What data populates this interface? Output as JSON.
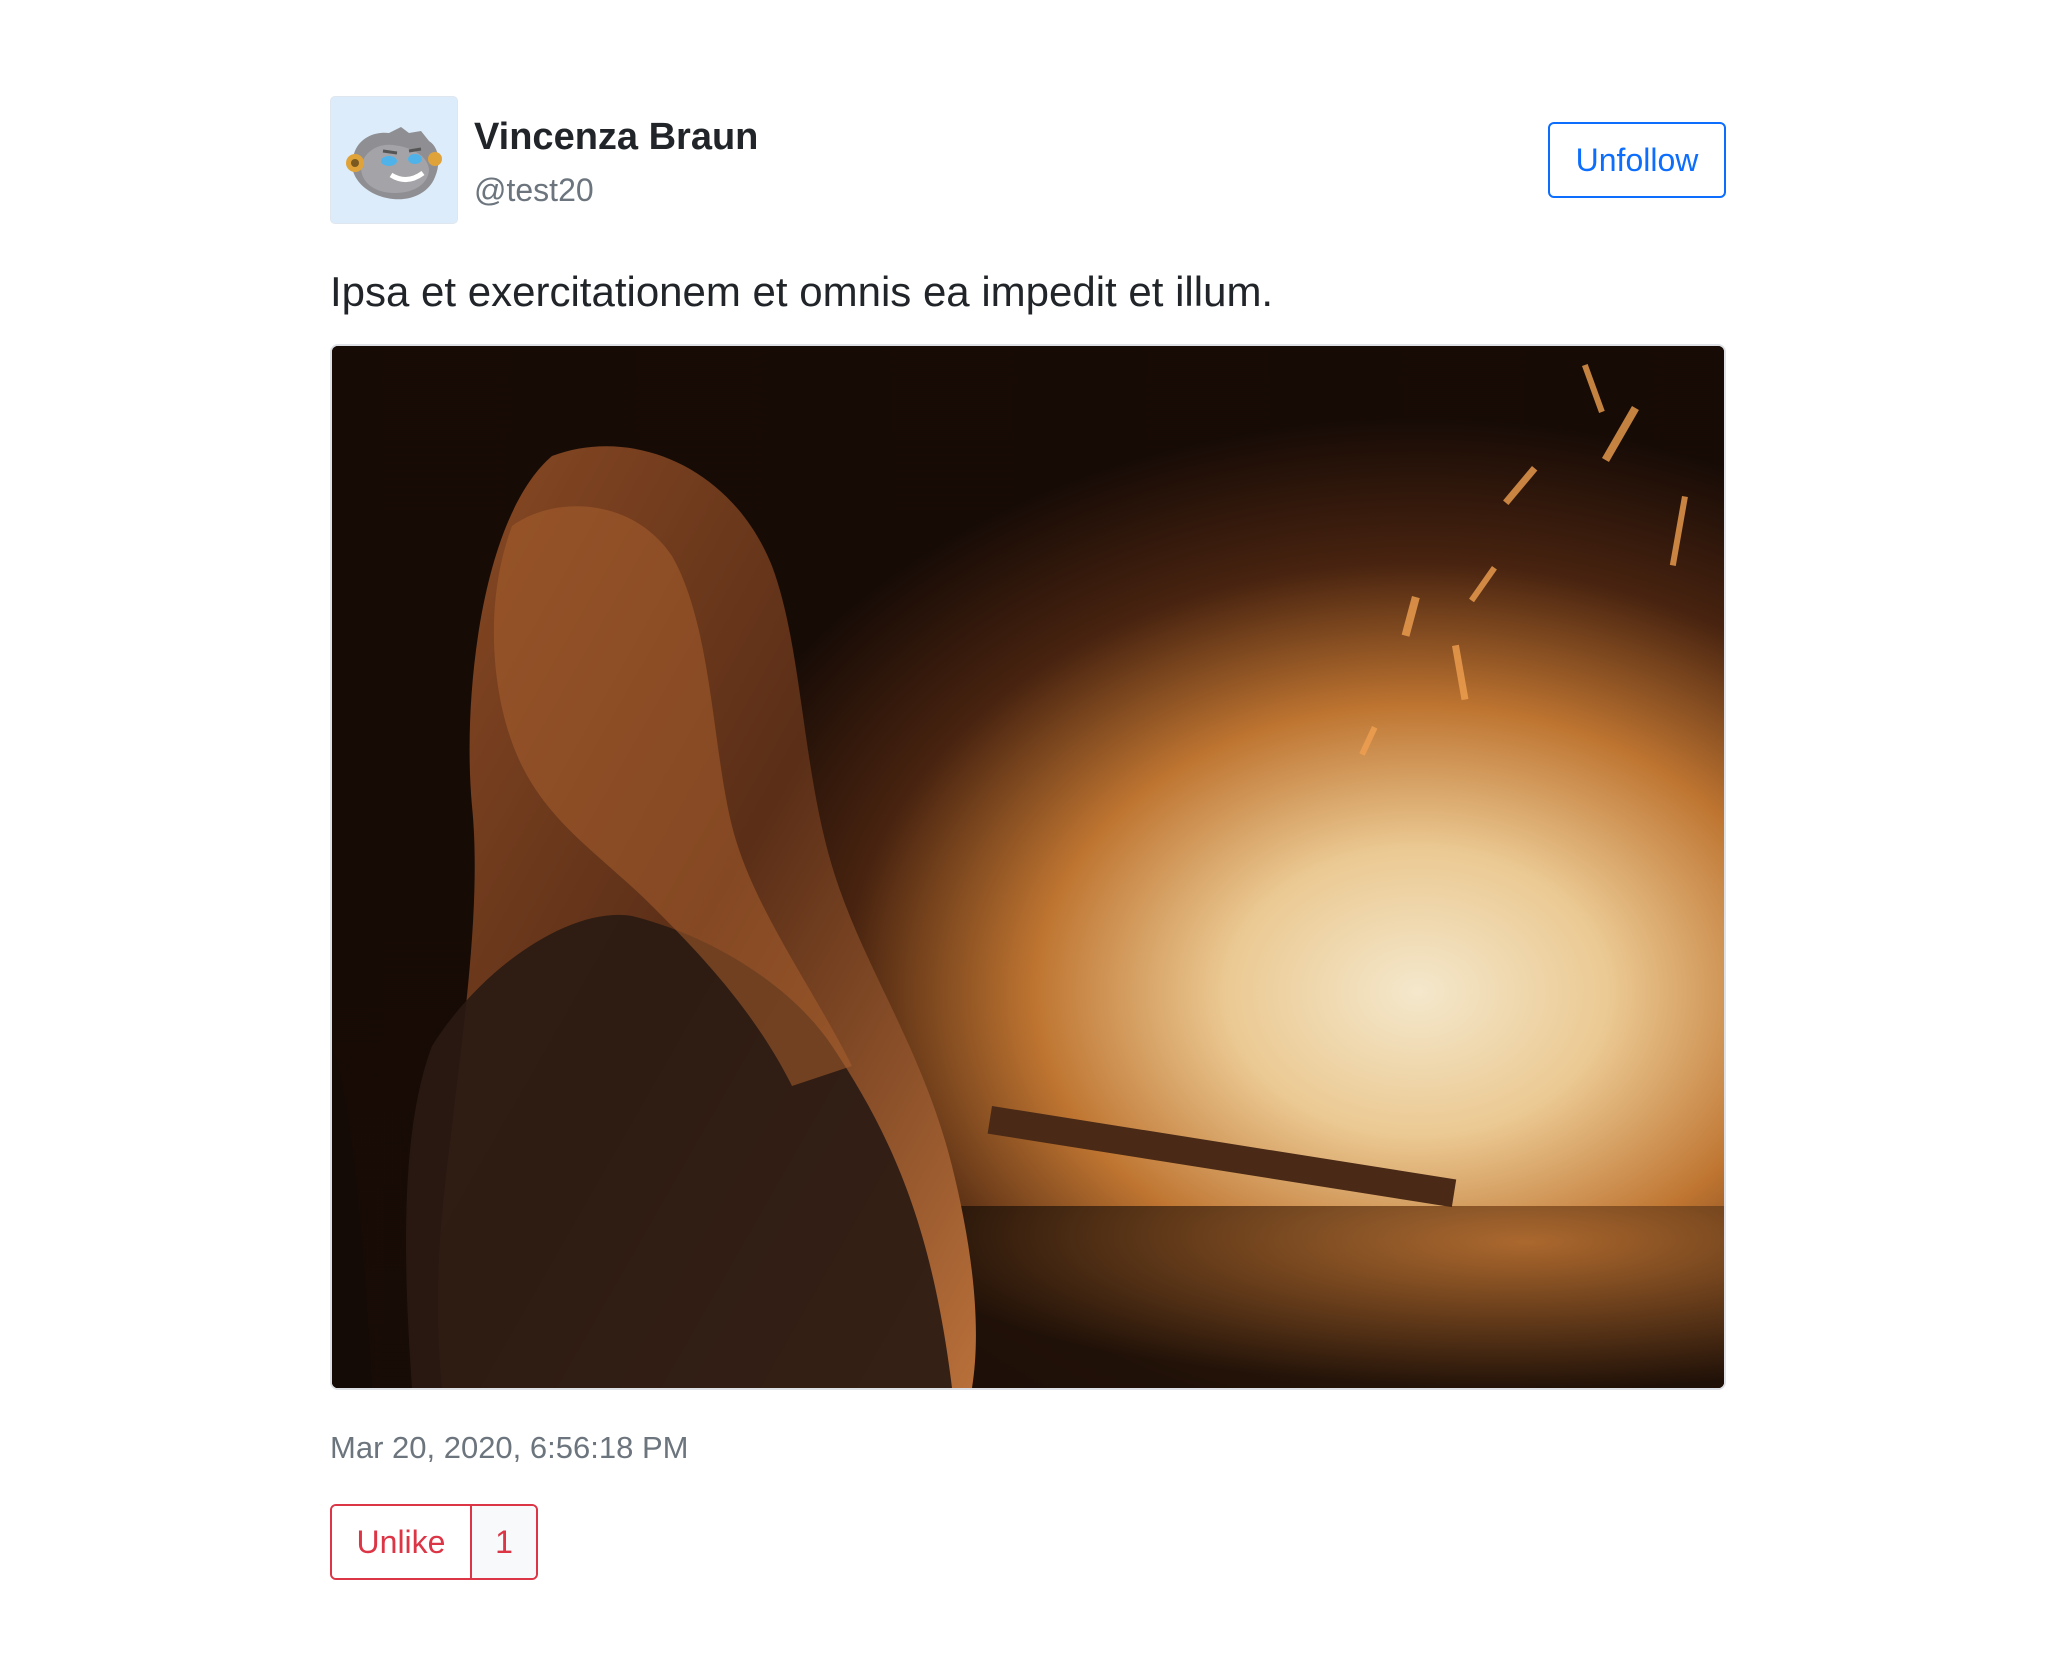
{
  "post": {
    "author": {
      "name": "Vincenza Braun",
      "handle": "@test20",
      "avatar_icon": "robot-avatar-icon"
    },
    "follow_button_label": "Unfollow",
    "text": "Ipsa et exercitationem et omnis ea impedit et illum.",
    "image": {
      "subject": "photo-image"
    },
    "timestamp": "Mar 20, 2020, 6:56:18 PM",
    "like": {
      "button_label": "Unlike",
      "count": "1"
    }
  },
  "colors": {
    "primary": "#0d6efd",
    "danger": "#dc3545",
    "muted": "#6c757d",
    "text": "#212529"
  }
}
